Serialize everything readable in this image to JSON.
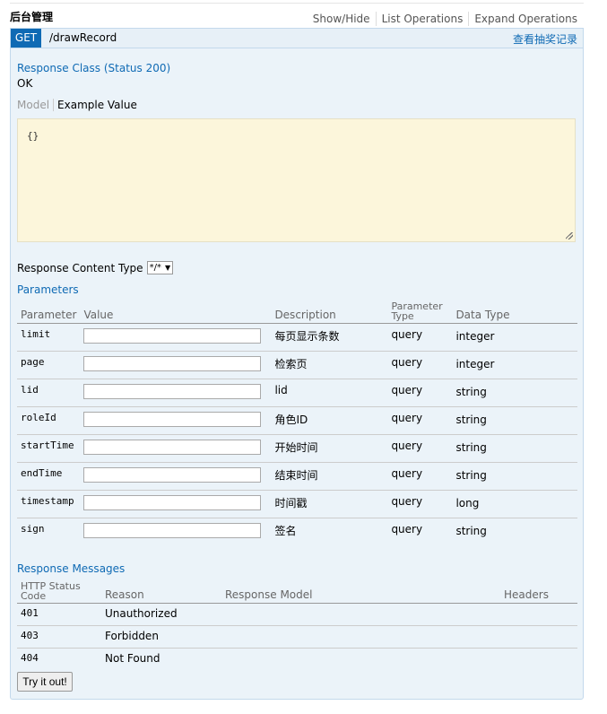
{
  "resource": {
    "title": "后台管理",
    "links": [
      "Show/Hide",
      "List Operations",
      "Expand Operations"
    ]
  },
  "operation": {
    "method": "GET",
    "path": "/drawRecord",
    "summary": "查看抽奖记录",
    "method_color": "#0f6ab4"
  },
  "response_class": {
    "heading": "Response Class (Status 200)",
    "status_text": "OK",
    "tabs": {
      "model": "Model",
      "example": "Example Value"
    },
    "example_value": "{}"
  },
  "content_type": {
    "label": "Response Content Type",
    "selected": "*/*",
    "arrow": "▼"
  },
  "parameters": {
    "heading": "Parameters",
    "columns": [
      "Parameter",
      "Value",
      "Description",
      "Parameter Type",
      "Data Type"
    ],
    "rows": [
      {
        "name": "limit",
        "value": "",
        "description": "每页显示条数",
        "param_type": "query",
        "data_type": "integer"
      },
      {
        "name": "page",
        "value": "",
        "description": "检索页",
        "param_type": "query",
        "data_type": "integer"
      },
      {
        "name": "lid",
        "value": "",
        "description": "lid",
        "param_type": "query",
        "data_type": "string"
      },
      {
        "name": "roleId",
        "value": "",
        "description": "角色ID",
        "param_type": "query",
        "data_type": "string"
      },
      {
        "name": "startTime",
        "value": "",
        "description": "开始时间",
        "param_type": "query",
        "data_type": "string"
      },
      {
        "name": "endTime",
        "value": "",
        "description": "结束时间",
        "param_type": "query",
        "data_type": "string"
      },
      {
        "name": "timestamp",
        "value": "",
        "description": "时间戳",
        "param_type": "query",
        "data_type": "long"
      },
      {
        "name": "sign",
        "value": "",
        "description": "签名",
        "param_type": "query",
        "data_type": "string"
      }
    ]
  },
  "response_messages": {
    "heading": "Response Messages",
    "columns": [
      "HTTP Status Code",
      "Reason",
      "Response Model",
      "Headers"
    ],
    "rows": [
      {
        "code": "401",
        "reason": "Unauthorized"
      },
      {
        "code": "403",
        "reason": "Forbidden"
      },
      {
        "code": "404",
        "reason": "Not Found"
      }
    ]
  },
  "try_button": "Try it out!"
}
